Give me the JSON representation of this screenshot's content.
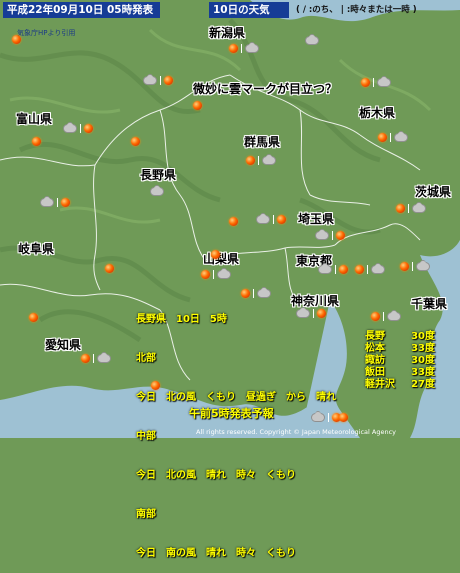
{
  "header": {
    "issued": "平成22年09月10日 05時発表",
    "target_day": "10日の天気",
    "legend": "( / :のち、 | :時々または一時 )"
  },
  "credit": "気象庁HPより引用",
  "note": "微妙に雲マークが目立つ？",
  "prefectures": [
    {
      "label": "新潟県"
    },
    {
      "label": "富山県"
    },
    {
      "label": "栃木県"
    },
    {
      "label": "群馬県"
    },
    {
      "label": "長野県"
    },
    {
      "label": "茨城県"
    },
    {
      "label": "埼玉県"
    },
    {
      "label": "岐阜県"
    },
    {
      "label": "山梨県"
    },
    {
      "label": "東京都"
    },
    {
      "label": "神奈川県"
    },
    {
      "label": "千葉県"
    },
    {
      "label": "愛知県"
    }
  ],
  "forecast": {
    "lines": [
      "長野県　10日　5時",
      "北部",
      "今日　北の風　くもり　昼過ぎ　から　晴れ",
      "中部",
      "今日　北の風　晴れ　時々　くもり",
      "南部",
      "今日　南の風　晴れ　時々　くもり"
    ]
  },
  "temperatures": [
    {
      "place": "長野",
      "temp": "30度"
    },
    {
      "place": "松本",
      "temp": "33度"
    },
    {
      "place": "諏訪",
      "temp": "30度"
    },
    {
      "place": "飯田",
      "temp": "33度"
    },
    {
      "place": "軽井沢",
      "temp": "27度"
    }
  ],
  "footer": "午前5時発表予報",
  "copyright": "All rights reserved. Copyright © Japan Meteorological Agency",
  "colors": {
    "header_bg": "#163c96",
    "forecast_text": "#ffff00",
    "sea": "#9ec1d3",
    "land": "#6f9a57"
  }
}
